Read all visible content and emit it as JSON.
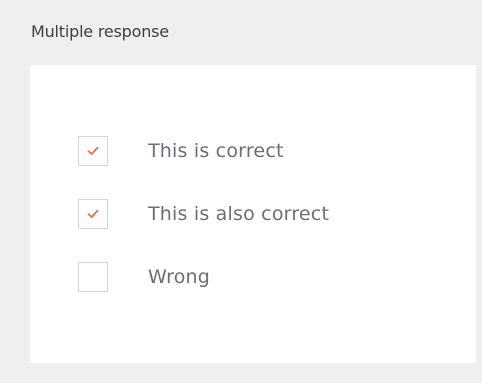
{
  "section": {
    "title": "Multiple response"
  },
  "options": [
    {
      "label": "This is correct",
      "checked": true,
      "icon": "checkmark-icon"
    },
    {
      "label": "This is also correct",
      "checked": true,
      "icon": "checkmark-icon"
    },
    {
      "label": "Wrong",
      "checked": false
    }
  ],
  "colors": {
    "page_background": "#efefef",
    "card_background": "#ffffff",
    "checkbox_border": "#d6d6d6",
    "check_mark": "#f26b3a",
    "label_text": "#6a6f77",
    "title_text": "#3f3f3f"
  }
}
